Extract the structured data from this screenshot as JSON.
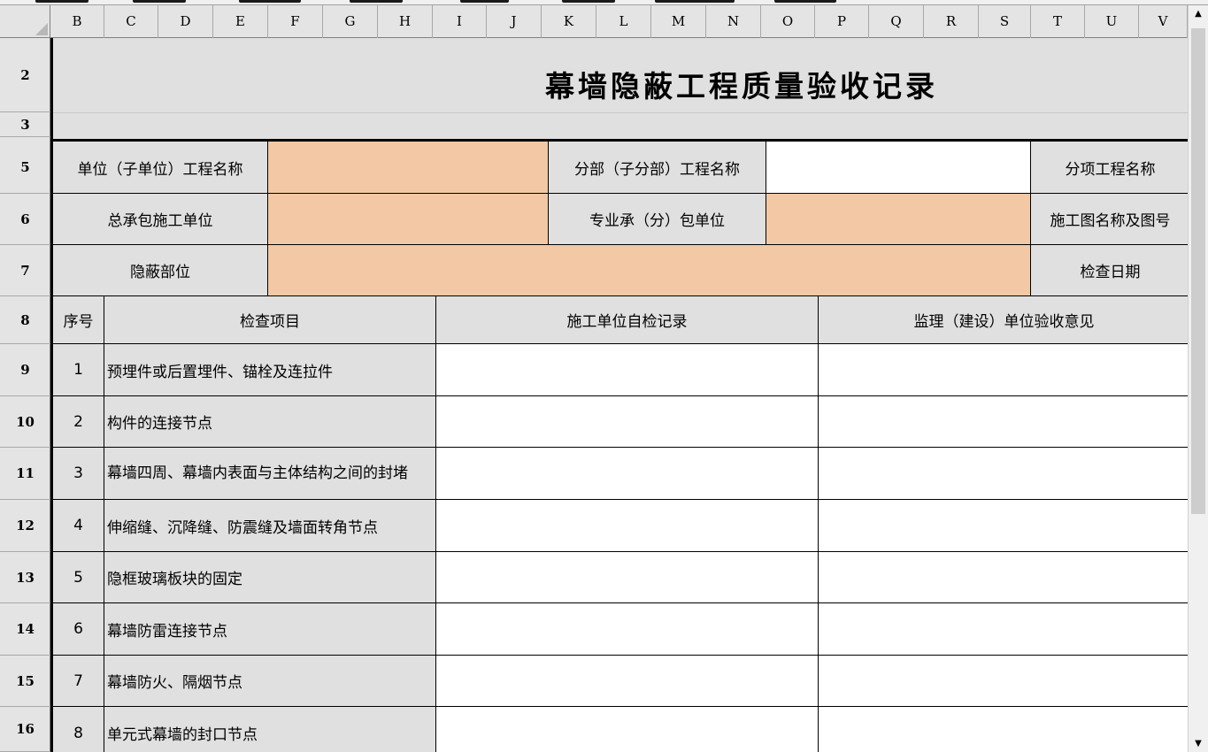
{
  "window": {
    "col_headers": [
      "B",
      "C",
      "D",
      "E",
      "F",
      "G",
      "H",
      "I",
      "J",
      "K",
      "L",
      "M",
      "N",
      "O",
      "P",
      "Q",
      "R",
      "S",
      "T",
      "U",
      "V"
    ],
    "row_headers": [
      "2",
      "3",
      "5",
      "6",
      "7",
      "8",
      "9",
      "10",
      "11",
      "12",
      "13",
      "14",
      "15",
      "16"
    ],
    "scroll_up_icon": "triangle-up-icon",
    "scroll_down_icon": "triangle-down-icon"
  },
  "form": {
    "title": "幕墙隐蔽工程质量验收记录",
    "header_fields": {
      "unit_project_name_label": "单位（子单位）工程名称",
      "unit_project_name_value": "",
      "subdivision_name_label": "分部（子分部）工程名称",
      "subdivision_name_value": "",
      "sub_item_name_label": "分项工程名称",
      "general_contractor_label": "总承包施工单位",
      "general_contractor_value": "",
      "specialty_contractor_label": "专业承（分）包单位",
      "specialty_contractor_value": "",
      "drawing_name_label": "施工图名称及图号",
      "concealed_location_label": "隐蔽部位",
      "concealed_location_value": "",
      "inspection_date_label": "检查日期"
    },
    "table_headers": {
      "seq": "序号",
      "item": "检查项目",
      "self_check": "施工单位自检记录",
      "supervision_opinion": "监理（建设）单位验收意见"
    },
    "items": [
      {
        "seq": "1",
        "item": "预埋件或后置埋件、锚栓及连拉件",
        "self_check": "",
        "opinion": ""
      },
      {
        "seq": "2",
        "item": "构件的连接节点",
        "self_check": "",
        "opinion": ""
      },
      {
        "seq": "3",
        "item": "幕墙四周、幕墙内表面与主体结构之间的封堵",
        "self_check": "",
        "opinion": ""
      },
      {
        "seq": "4",
        "item": "伸缩缝、沉降缝、防震缝及墙面转角节点",
        "self_check": "",
        "opinion": ""
      },
      {
        "seq": "5",
        "item": "隐框玻璃板块的固定",
        "self_check": "",
        "opinion": ""
      },
      {
        "seq": "6",
        "item": "幕墙防雷连接节点",
        "self_check": "",
        "opinion": ""
      },
      {
        "seq": "7",
        "item": "幕墙防火、隔烟节点",
        "self_check": "",
        "opinion": ""
      },
      {
        "seq": "8",
        "item": "单元式幕墙的封口节点",
        "self_check": "",
        "opinion": ""
      }
    ]
  },
  "colors": {
    "header_gray": "#e0e0e0",
    "input_orange": "#f2c9a4",
    "sheet_chrome": "#e4e4e4"
  }
}
